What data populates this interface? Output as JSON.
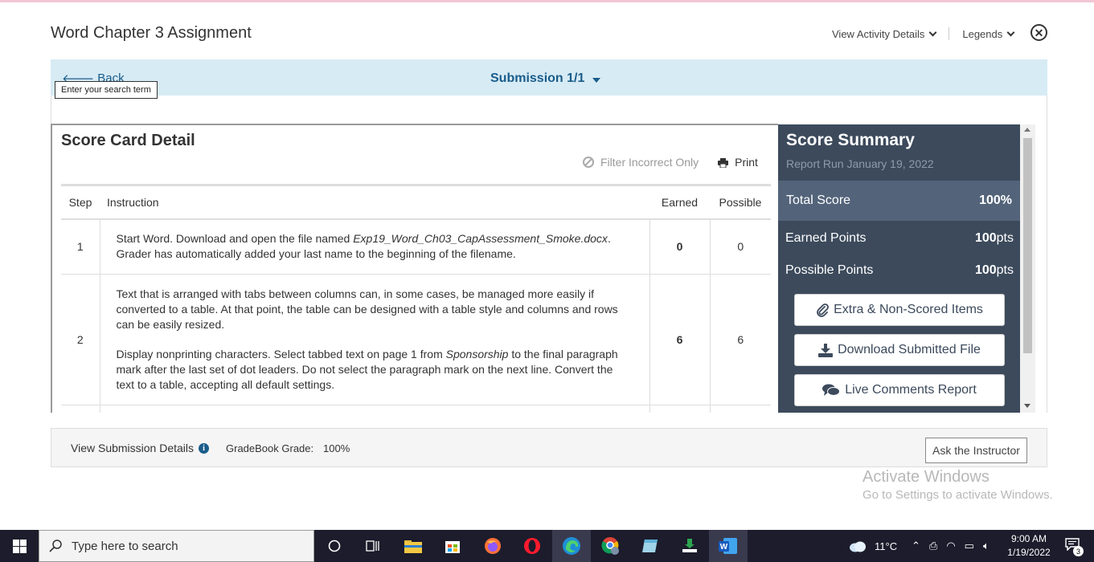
{
  "header": {
    "title": "Word Chapter 3 Assignment",
    "view_activity_label": "View Activity Details",
    "legends_label": "Legends"
  },
  "subbar": {
    "back_label": "Back",
    "submission_label": "Submission 1/1",
    "tooltip": "Enter your search term"
  },
  "scorecard": {
    "title": "Score Card Detail",
    "filter_label": "Filter Incorrect Only",
    "print_label": "Print",
    "columns": [
      "Step",
      "Instruction",
      "Earned",
      "Possible"
    ],
    "rows": [
      {
        "step": "1",
        "instruction_parts": {
          "a": "Start Word. Download and open the file named ",
          "b": "Exp19_Word_Ch03_CapAssessment_Smoke.docx",
          "c": ". Grader has automatically added your last name to the beginning of the filename."
        },
        "earned": "0",
        "possible": "0"
      },
      {
        "step": "2",
        "instruction_p1": "Text that is arranged with tabs between columns can, in some cases, be managed more easily if converted to a table. At that point, the table can be designed with a table style and columns and rows can be easily resized.",
        "instruction_p2_parts": {
          "a": "Display nonprinting characters. Select tabbed text on page 1 from ",
          "b": "Sponsorship",
          "c": " to the final paragraph mark after the last set of dot leaders. Do not select the paragraph mark on the next line. Convert the text to a table, accepting all default settings."
        },
        "earned": "6",
        "possible": "6"
      }
    ]
  },
  "summary": {
    "title": "Score Summary",
    "report_date": "Report Run January 19, 2022",
    "total_label": "Total Score",
    "total_value": "100%",
    "earned_label": "Earned Points",
    "earned_value": "100",
    "possible_label": "Possible Points",
    "possible_value": "100",
    "points_unit": "pts",
    "buttons": {
      "extra": "Extra & Non-Scored Items",
      "download": "Download Submitted File",
      "comments": "Live Comments Report"
    }
  },
  "footer": {
    "details_label": "View Submission Details",
    "grade_label": "GradeBook Grade:",
    "grade_value": "100%",
    "ask_label": "Ask the Instructor"
  },
  "watermark": {
    "line1": "Activate Windows",
    "line2": "Go to Settings to activate Windows."
  },
  "taskbar": {
    "search_placeholder": "Type here to search",
    "weather": "11°C",
    "time": "9:00 AM",
    "date": "1/19/2022",
    "notifications": "3"
  },
  "colors": {
    "subbar_bg": "#d7ebf5",
    "link_blue": "#1a5c8a",
    "summary_bg": "#3c4a5c",
    "summary_total_bg": "#53647a",
    "taskbar_bg": "#1c1c2c"
  }
}
